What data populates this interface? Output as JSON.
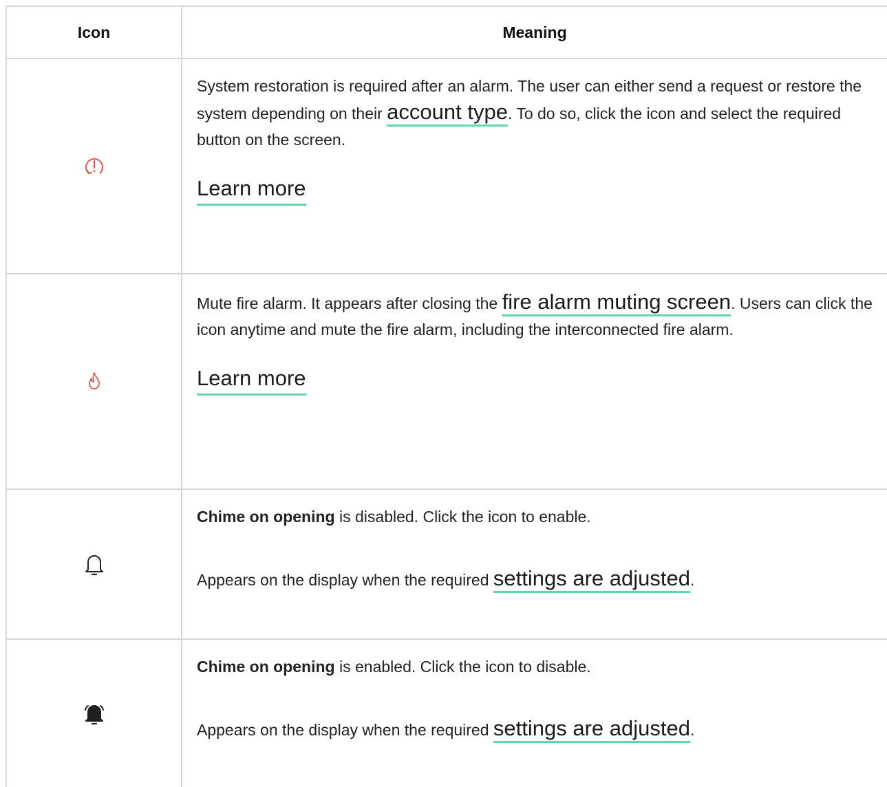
{
  "header": {
    "icon_col": "Icon",
    "meaning_col": "Meaning"
  },
  "rows": [
    {
      "icon": "alarm-restore-icon",
      "text_before": "System restoration is required after an alarm. The user can either send a request or restore the system depending on their ",
      "link": "account type",
      "text_after": ". To do so, click the icon and select the required button on the screen.",
      "learn_more": "Learn more"
    },
    {
      "icon": "fire-icon",
      "text_before": "Mute fire alarm. It appears after closing the ",
      "link": "fire alarm muting screen",
      "text_after": ". Users can click the icon anytime and mute the fire alarm, including the interconnected fire alarm.",
      "learn_more": "Learn more"
    },
    {
      "icon": "bell-outline-icon",
      "bold": "Chime on opening",
      "line1_rest": " is disabled. Click the icon to enable.",
      "line2_before": "Appears on the display when the required ",
      "link": "settings are adjusted",
      "line2_after": "."
    },
    {
      "icon": "bell-ringing-icon",
      "bold": "Chime on opening",
      "line1_rest": " is enabled. Click the icon to disable.",
      "line2_before": "Appears on the display when the required ",
      "link": "settings are adjusted",
      "line2_after": "."
    }
  ],
  "colors": {
    "accent_underline": "#5ed8a4",
    "alert_icon": "#e2574c",
    "border": "#d7d7d7"
  }
}
